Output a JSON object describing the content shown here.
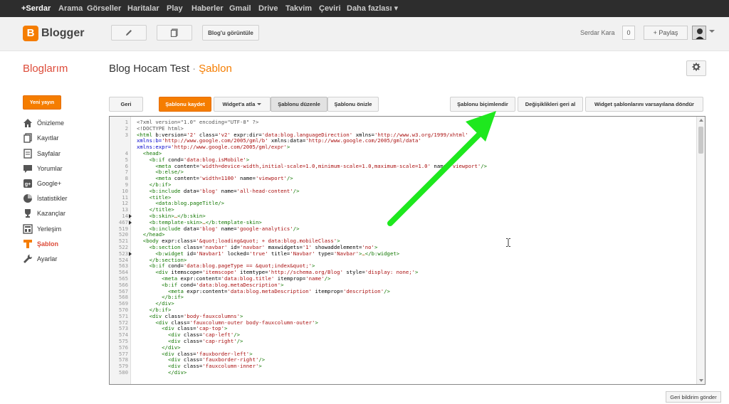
{
  "google_bar": {
    "items": [
      "+Serdar",
      "Arama",
      "Görseller",
      "Haritalar",
      "Play",
      "Haberler",
      "Gmail",
      "Drive",
      "Takvim",
      "Çeviri",
      "Daha fazlası ▾"
    ]
  },
  "header": {
    "logo_letter": "B",
    "logo_text": "Blogger",
    "view_blog_label": "Blog'u görüntüle",
    "user_name": "Serdar Kara",
    "notification_count": "0",
    "share_label": "+ Paylaş",
    "icons": [
      "pencil-icon",
      "posts-icon",
      "gear-icon"
    ]
  },
  "title_row": {
    "my_blogs": "Bloglarım",
    "blog_name": "Blog Hocam Test",
    "separator": "·",
    "section": "Şablon"
  },
  "sidebar": {
    "new_post": "Yeni yayın",
    "items": [
      {
        "label": "Önizleme",
        "icon": "home-icon"
      },
      {
        "label": "Kayıtlar",
        "icon": "posts-icon"
      },
      {
        "label": "Sayfalar",
        "icon": "pages-icon"
      },
      {
        "label": "Yorumlar",
        "icon": "comment-icon"
      },
      {
        "label": "Google+",
        "icon": "google-plus-icon"
      },
      {
        "label": "İstatistikler",
        "icon": "pie-chart-icon"
      },
      {
        "label": "Kazançlar",
        "icon": "trophy-icon"
      },
      {
        "label": "Yerleşim",
        "icon": "layout-icon"
      },
      {
        "label": "Şablon",
        "icon": "template-icon"
      },
      {
        "label": "Ayarlar",
        "icon": "wrench-icon"
      }
    ],
    "active": "Şablon"
  },
  "toolbar": {
    "back": "Geri",
    "save": "Şablonu kaydet",
    "jump_widget": "Widget'a atla",
    "edit": "Şablonu düzenle",
    "preview": "Şablonu önizle",
    "format": "Şablonu biçimlendir",
    "revert": "Değişiklikleri geri al",
    "reset_widgets": "Widget şablonlarını varsayılana döndür"
  },
  "editor": {
    "lines": [
      {
        "n": "1",
        "c": "<?xml version=\"1.0\" encoding=\"UTF-8\" ?>"
      },
      {
        "n": "2",
        "c": "<!DOCTYPE html>"
      },
      {
        "n": "3",
        "c": "<html b:version='2' class='v2' expr:dir='data:blog.languageDirection' xmlns='http://www.w3.org/1999/xhtml'"
      },
      {
        "n": "",
        "c": "xmlns:b='http://www.google.com/2005/gml/b' xmlns:data='http://www.google.com/2005/gml/data'"
      },
      {
        "n": "",
        "c": "xmlns:expr='http://www.google.com/2005/gml/expr'>"
      },
      {
        "n": "4",
        "c": "  <head>"
      },
      {
        "n": "5",
        "c": "    <b:if cond='data:blog.isMobile'>"
      },
      {
        "n": "6",
        "c": "      <meta content='width=device-width,initial-scale=1.0,minimum-scale=1.0,maximum-scale=1.0' name='viewport'/>"
      },
      {
        "n": "7",
        "c": "      <b:else/>"
      },
      {
        "n": "8",
        "c": "      <meta content='width=1100' name='viewport'/>"
      },
      {
        "n": "9",
        "c": "    </b:if>"
      },
      {
        "n": "10",
        "c": "    <b:include data='blog' name='all-head-content'/>"
      },
      {
        "n": "11",
        "c": "    <title>"
      },
      {
        "n": "12",
        "c": "      <data:blog.pageTitle/>"
      },
      {
        "n": "13",
        "c": "    </title>"
      },
      {
        "n": "14",
        "c": "    <b:skin>…</b:skin>",
        "fold": true
      },
      {
        "n": "467",
        "c": "    <b:template-skin>…</b:template-skin>",
        "fold": true
      },
      {
        "n": "519",
        "c": "    <b:include data='blog' name='google-analytics'/>"
      },
      {
        "n": "520",
        "c": "  </head>"
      },
      {
        "n": "521",
        "c": "  <body expr:class='&quot;loading&quot; + data:blog.mobileClass'>"
      },
      {
        "n": "522",
        "c": "    <b:section class='navbar' id='navbar' maxwidgets='1' showaddelement='no'>"
      },
      {
        "n": "523",
        "c": "      <b:widget id='Navbar1' locked='true' title='Navbar' type='Navbar'>…</b:widget>",
        "fold": true
      },
      {
        "n": "524",
        "c": "    </b:section>"
      },
      {
        "n": "563",
        "c": "    <b:if cond='data:blog.pageType == &quot;index&quot;'>"
      },
      {
        "n": "564",
        "c": "      <div itemscope='itemscope' itemtype='http://schema.org/Blog' style='display: none;'>"
      },
      {
        "n": "565",
        "c": "        <meta expr:content='data:blog.title' itemprop='name'/>"
      },
      {
        "n": "566",
        "c": "        <b:if cond='data:blog.metaDescription'>"
      },
      {
        "n": "567",
        "c": "          <meta expr:content='data:blog.metaDescription' itemprop='description'/>"
      },
      {
        "n": "568",
        "c": "        </b:if>"
      },
      {
        "n": "569",
        "c": "      </div>"
      },
      {
        "n": "570",
        "c": "    </b:if>"
      },
      {
        "n": "571",
        "c": "    <div class='body-fauxcolumns'>"
      },
      {
        "n": "572",
        "c": "      <div class='fauxcolumn-outer body-fauxcolumn-outer'>"
      },
      {
        "n": "573",
        "c": "        <div class='cap-top'>"
      },
      {
        "n": "574",
        "c": "          <div class='cap-left'/>"
      },
      {
        "n": "575",
        "c": "          <div class='cap-right'/>"
      },
      {
        "n": "576",
        "c": "        </div>"
      },
      {
        "n": "577",
        "c": "        <div class='fauxborder-left'>"
      },
      {
        "n": "578",
        "c": "          <div class='fauxborder-right'/>"
      },
      {
        "n": "579",
        "c": "          <div class='fauxcolumn-inner'>"
      },
      {
        "n": "580",
        "c": "          </div>"
      }
    ]
  },
  "feedback": "Geri bildirim gönder",
  "colors": {
    "accent": "#f57d00",
    "title_red": "#dd4b39",
    "annotation_arrow": "#1ee81e",
    "google_bar": "#2d2d2d"
  }
}
